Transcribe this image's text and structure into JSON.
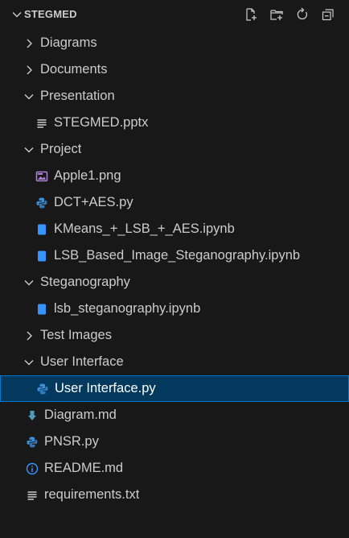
{
  "explorer": {
    "root_label": "STEGMED",
    "actions": [
      {
        "name": "new-file-icon"
      },
      {
        "name": "new-folder-icon"
      },
      {
        "name": "refresh-icon"
      },
      {
        "name": "collapse-all-icon"
      }
    ]
  },
  "tree": [
    {
      "label": "Diagrams",
      "type": "folder",
      "expanded": false
    },
    {
      "label": "Documents",
      "type": "folder",
      "expanded": false
    },
    {
      "label": "Presentation",
      "type": "folder",
      "expanded": true
    },
    {
      "label": "STEGMED.pptx",
      "type": "file",
      "icon": "lines-icon"
    },
    {
      "label": "Project",
      "type": "folder",
      "expanded": true
    },
    {
      "label": "Apple1.png",
      "type": "file",
      "icon": "image-icon"
    },
    {
      "label": "DCT+AES.py",
      "type": "file",
      "icon": "python-icon"
    },
    {
      "label": "KMeans_+_LSB_+_AES.ipynb",
      "type": "file",
      "icon": "notebook-icon"
    },
    {
      "label": "LSB_Based_Image_Steganography.ipynb",
      "type": "file",
      "icon": "notebook-icon"
    },
    {
      "label": "Steganography",
      "type": "folder",
      "expanded": true
    },
    {
      "label": "lsb_steganography.ipynb",
      "type": "file",
      "icon": "notebook-icon"
    },
    {
      "label": "Test Images",
      "type": "folder",
      "expanded": false
    },
    {
      "label": "User Interface",
      "type": "folder",
      "expanded": true
    },
    {
      "label": "User Interface.py",
      "type": "file",
      "icon": "python-icon",
      "selected": true
    },
    {
      "label": "Diagram.md",
      "type": "file",
      "icon": "markdown-icon"
    },
    {
      "label": "PNSR.py",
      "type": "file",
      "icon": "python-icon"
    },
    {
      "label": "README.md",
      "type": "file",
      "icon": "info-icon"
    },
    {
      "label": "requirements.txt",
      "type": "file",
      "icon": "lines-icon"
    }
  ],
  "colors": {
    "background": "#181818",
    "text": "#cccccc",
    "selection_bg": "#04395e",
    "selection_border": "#0078d4",
    "python": "#3b8fd6",
    "notebook": "#3794ff",
    "image": "#b180d7",
    "markdown": "#519aba",
    "info": "#3794ff"
  }
}
